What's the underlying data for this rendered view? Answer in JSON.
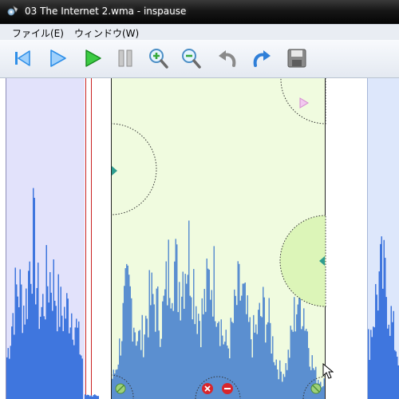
{
  "window": {
    "title": "03 The Internet 2.wma - inspause"
  },
  "menu": {
    "items": [
      {
        "label": "ファイル(E)"
      },
      {
        "label": "ウィンドウ(W)"
      }
    ]
  },
  "toolbar": {
    "buttons": [
      {
        "name": "skip-to-start",
        "icon": "skip-start-icon",
        "color": "#2f8fe8"
      },
      {
        "name": "play",
        "icon": "play-blue-icon",
        "color": "#2f8fe8"
      },
      {
        "name": "play-selection",
        "icon": "play-green-icon",
        "color": "#1fae2e"
      },
      {
        "name": "pause",
        "icon": "pause-icon",
        "color": "#9a9a9a"
      },
      {
        "name": "zoom-in",
        "icon": "zoom-in-icon",
        "color": "#43b13f"
      },
      {
        "name": "zoom-out",
        "icon": "zoom-out-icon",
        "color": "#43b13f"
      },
      {
        "name": "undo",
        "icon": "undo-icon",
        "color": "#8a8a8a"
      },
      {
        "name": "redo",
        "icon": "redo-icon",
        "color": "#2f7fd8"
      },
      {
        "name": "save",
        "icon": "save-icon",
        "color": "#777777"
      }
    ]
  },
  "waveform": {
    "wave_color": "#3f76de",
    "selection_wave_color": "#5b8fd0",
    "selection_color": "#f0fbdf",
    "left_pane_color": "#e2e2fb",
    "right_pane_color": "#dde7fb",
    "marker_color": "#c92020",
    "handle_color": "#2e9d8f"
  }
}
